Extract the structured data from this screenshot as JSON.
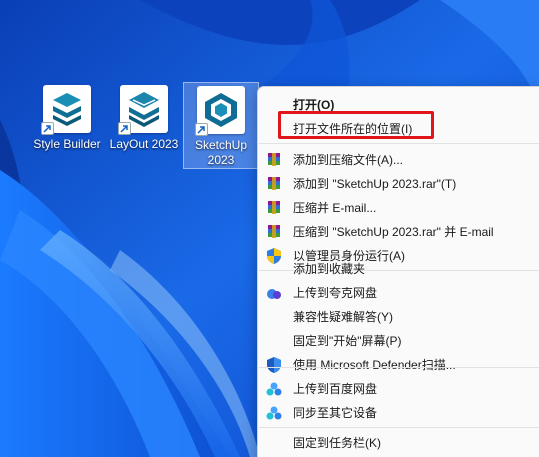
{
  "desktop": {
    "icons": [
      {
        "label": "Style Builder",
        "icon": "style-builder-icon"
      },
      {
        "label": "LayOut 2023",
        "icon": "layout-icon"
      },
      {
        "label": "SketchUp\n2023",
        "icon": "sketchup-icon"
      }
    ]
  },
  "context_menu": {
    "items": [
      {
        "label": "打开(O)",
        "icon": ""
      },
      {
        "label": "打开文件所在的位置(I)",
        "icon": ""
      },
      {
        "label": "添加到压缩文件(A)...",
        "icon": "winrar-icon"
      },
      {
        "label": "添加到 \"SketchUp 2023.rar\"(T)",
        "icon": "winrar-icon"
      },
      {
        "label": "压缩并 E-mail...",
        "icon": "winrar-icon"
      },
      {
        "label": "压缩到 \"SketchUp 2023.rar\" 并 E-mail",
        "icon": "winrar-icon"
      },
      {
        "label": "以管理员身份运行(A)",
        "icon": "uac-shield-icon"
      },
      {
        "label": "添加到收藏夹",
        "icon": ""
      },
      {
        "label": "上传到夸克网盘",
        "icon": "quark-cloud-icon"
      },
      {
        "label": "兼容性疑难解答(Y)",
        "icon": ""
      },
      {
        "label": "固定到\"开始\"屏幕(P)",
        "icon": ""
      },
      {
        "label": "使用 Microsoft Defender扫描...",
        "icon": "defender-shield-icon"
      },
      {
        "label": "上传到百度网盘",
        "icon": "baidu-cloud-icon"
      },
      {
        "label": "同步至其它设备",
        "icon": "baidu-sync-icon"
      },
      {
        "label": "固定到任务栏(K)",
        "icon": ""
      }
    ]
  },
  "colors": {
    "highlight_border": "#e0161b",
    "menu_bg": "#fafafa",
    "wallpaper_blue": "#1a5fd6"
  }
}
